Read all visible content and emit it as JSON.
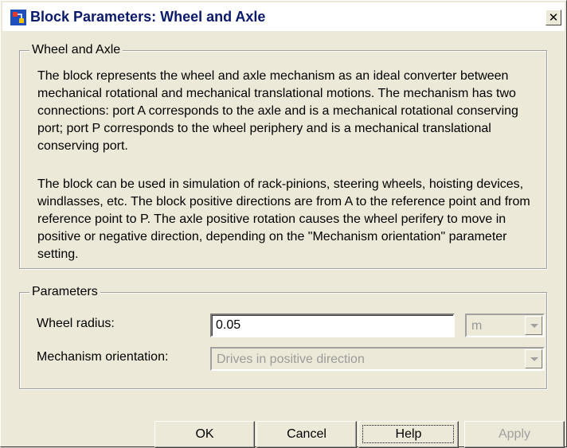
{
  "window": {
    "title": "Block Parameters: Wheel and Axle",
    "close_glyph": "✕",
    "icon": "simulink-block-icon"
  },
  "description": {
    "legend": "Wheel and Axle",
    "paragraph1": "The block represents the wheel and axle mechanism as an ideal converter between mechanical rotational and mechanical translational motions. The mechanism has two connections: port A corresponds to the axle and is a mechanical rotational conserving port; port P corresponds to the wheel periphery and is a mechanical translational conserving port.",
    "paragraph2": "The block can be used in simulation of rack-pinions, steering wheels, hoisting devices, windlasses, etc. The block positive directions are from A to the reference point and from reference point to P. The axle positive rotation causes the wheel perifery to move in positive or negative direction, depending on the \"Mechanism orientation\" parameter setting."
  },
  "parameters": {
    "legend": "Parameters",
    "wheel_radius": {
      "label": "Wheel radius:",
      "value": "0.05",
      "unit": "m"
    },
    "orientation": {
      "label": "Mechanism orientation:",
      "value": "Drives in positive direction"
    }
  },
  "buttons": {
    "ok": "OK",
    "cancel": "Cancel",
    "help": "Help",
    "apply": "Apply"
  },
  "colors": {
    "title_text": "#0b1a6a",
    "dialog_bg": "#ece9d8",
    "disabled_text": "#a0a0a0"
  }
}
